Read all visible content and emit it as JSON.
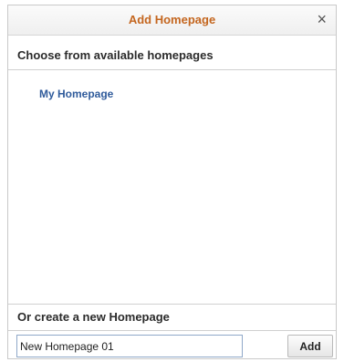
{
  "dialog": {
    "title": "Add Homepage",
    "close_symbol": "×"
  },
  "choose_section": {
    "heading": "Choose from available homepages",
    "homepages": [
      "My Homepage"
    ]
  },
  "create_section": {
    "heading": "Or create a new Homepage",
    "input_value": "New Homepage 01",
    "add_label": "Add"
  },
  "colors": {
    "title": "#c4661f",
    "link": "#2f5b9b",
    "input_border": "#8fa8c8"
  },
  "icons": {
    "close": "close-icon"
  }
}
